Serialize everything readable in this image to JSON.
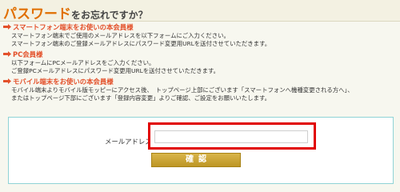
{
  "header": {
    "title_main": "パスワード",
    "title_sub": "をお忘れですか？"
  },
  "sections": [
    {
      "heading": "スマートフォン端末をお使いの本会員様",
      "lines": [
        "スマートフォン端末でご使用のメールアドレスを以下フォームにご入力ください。",
        "スマートフォン端末のご登録メールアドレスにパスワード変更用URLを送付させていただきます。"
      ]
    },
    {
      "heading": "PC会員様",
      "lines": [
        "以下フォームにPCメールアドレスをご入力ください。",
        "ご登録PCメールアドレスにパスワード変更用URLを送付させていただきます。"
      ]
    },
    {
      "heading": "モバイル端末をお使いの本会員様",
      "lines": [
        "モバイル端末よりモバイル版モッピーにアクセス後、　トップページ上部にございます「スマートフォンへ機種変更される方へ」、",
        "またはトップページ下部にございます「登録内容変更」よりご確認、ご設定をお願いいたします。"
      ]
    }
  ],
  "form": {
    "email_label": "メールアドレス",
    "email_value": "",
    "confirm_label": "確認"
  },
  "colors": {
    "accent": "#e06f00",
    "heading": "#e3502a",
    "button": "#c9a336",
    "highlight": "#e10000"
  },
  "icons": {
    "section_marker": "pointing-hand-icon"
  }
}
